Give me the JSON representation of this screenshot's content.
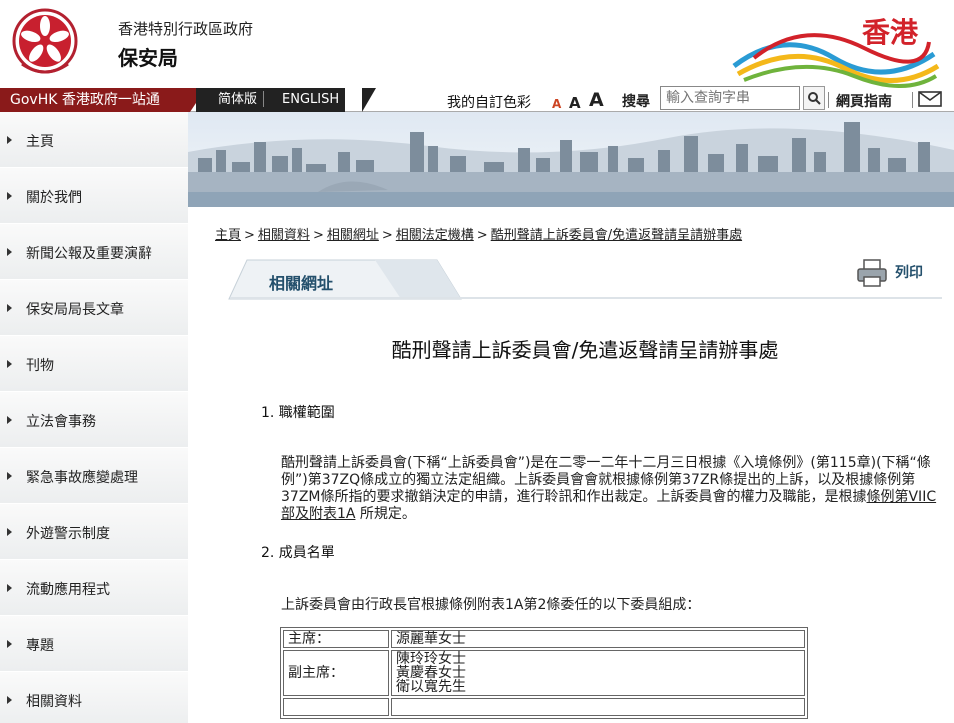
{
  "header": {
    "government": "香港特別行政區政府",
    "department": "保安局",
    "brand_text": "香港"
  },
  "govhk_bar": {
    "portal": "GovHK 香港政府一站通",
    "simplified": "简体版",
    "english": "ENGLISH",
    "custom_colour": "我的自訂色彩",
    "font_small": "A",
    "font_medium": "A",
    "font_large": "A",
    "search_label": "搜尋",
    "search_placeholder": "輸入查詢字串",
    "sitemap": "網頁指南"
  },
  "sidebar": {
    "items": [
      {
        "label": "主頁"
      },
      {
        "label": "關於我們"
      },
      {
        "label": "新聞公報及重要演辭"
      },
      {
        "label": "保安局局長文章"
      },
      {
        "label": "刊物"
      },
      {
        "label": "立法會事務"
      },
      {
        "label": "緊急事故應變處理"
      },
      {
        "label": "外遊警示制度"
      },
      {
        "label": "流動應用程式"
      },
      {
        "label": "專題"
      },
      {
        "label": "相關資料"
      }
    ]
  },
  "breadcrumb": {
    "items": [
      "主頁",
      "相關資料",
      "相關網址",
      "相關法定機構",
      "酷刑聲請上訴委員會/免遣返聲請呈請辦事處"
    ],
    "separator": ">"
  },
  "section": {
    "tab": "相關網址",
    "print": "列印"
  },
  "content": {
    "title": "酷刑聲請上訴委員會/免遣返聲請呈請辦事處",
    "heading1": "1. 職權範圍",
    "para1_a": "酷刑聲請上訴委員會(下稱“上訴委員會”)是在二零一二年十二月三日根據《入境條例》(第115章)(下稱“條例”)第37ZQ條成立的獨立法定組織。上訴委員會會就根據條例第37ZR條提出的上訴，以及根據條例第37ZM條所指的要求撤銷決定的申請，進行聆訊和作出裁定。上訴委員會的權力及職能，是根據",
    "para1_link": "條例第VIIC部及附表1A",
    "para1_b": " 所規定。",
    "heading2": "2. 成員名單",
    "para2": "上訴委員會由行政長官根據條例附表1A第2條委任的以下委員組成：",
    "members": [
      {
        "role": "主席：",
        "names": [
          "源麗華女士"
        ]
      },
      {
        "role": "副主席：",
        "names": [
          "陳玲玲女士",
          "黃慶春女士",
          "衛以寬先生"
        ]
      }
    ]
  },
  "colors": {
    "govhk_red": "#8a1a1a",
    "link_blue": "#24506c",
    "brand_red": "#d2222a"
  }
}
